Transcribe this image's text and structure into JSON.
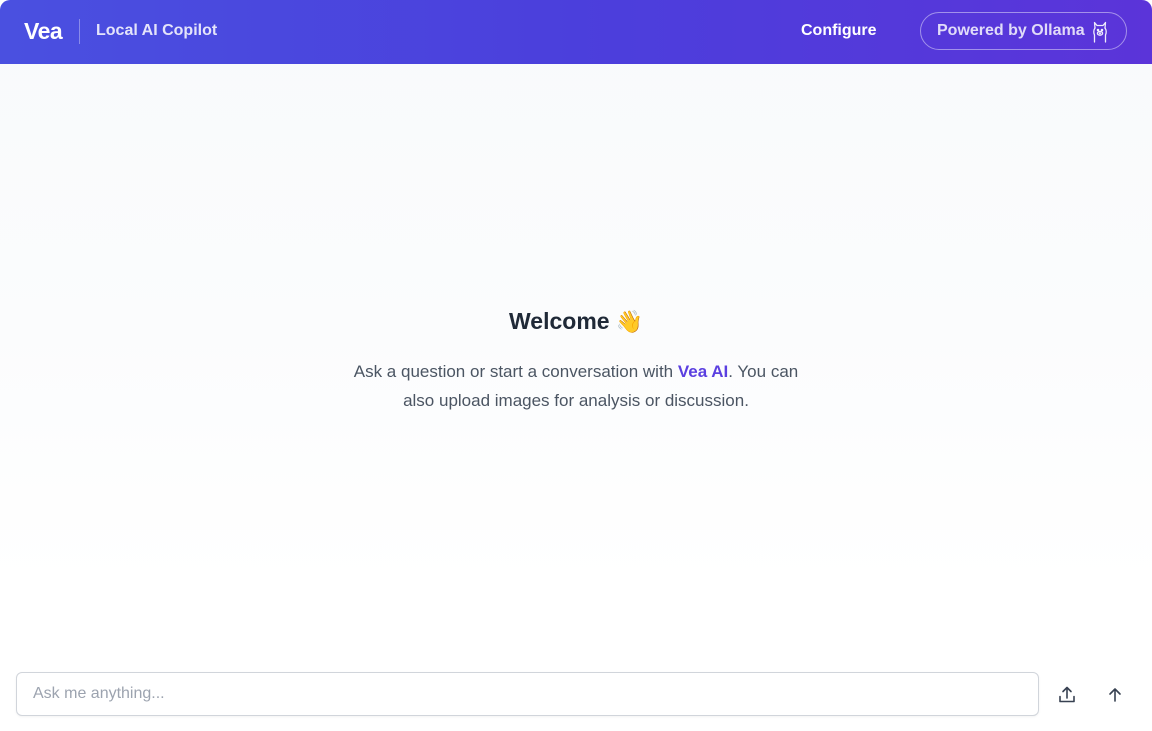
{
  "header": {
    "logo": "Vea",
    "subtitle": "Local AI Copilot",
    "configure_label": "Configure",
    "powered_label": "Powered by Ollama",
    "powered_icon": "llama-icon"
  },
  "welcome": {
    "title": "Welcome",
    "emoji": "👋",
    "text_before": "Ask a question or start a conversation with ",
    "brand": "Vea AI",
    "text_after": ". You can also upload images for analysis or discussion."
  },
  "composer": {
    "placeholder": "Ask me anything...",
    "value": "",
    "upload_icon": "upload-icon",
    "send_icon": "arrow-up-icon"
  },
  "colors": {
    "header_gradient_start": "#4a50e0",
    "header_gradient_end": "#5b34d9",
    "brand_accent": "#5b3fe0"
  }
}
